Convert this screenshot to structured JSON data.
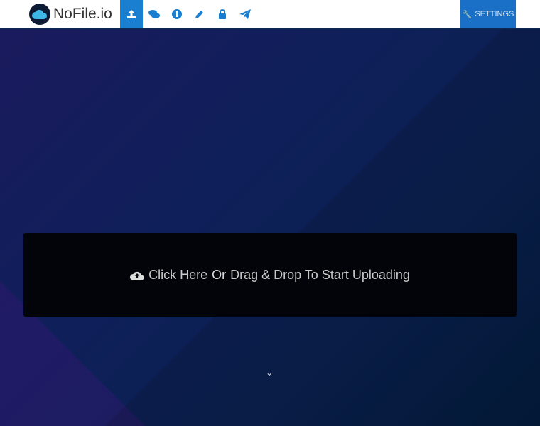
{
  "brand": {
    "name": "NoFile.io"
  },
  "nav": [
    {
      "icon": "upload-icon",
      "label": "Upload"
    },
    {
      "icon": "comments-icon",
      "label": "Chat"
    },
    {
      "icon": "info-icon",
      "label": "Info"
    },
    {
      "icon": "pencil-icon",
      "label": "Edit"
    },
    {
      "icon": "lock-icon",
      "label": "Secure"
    },
    {
      "icon": "paper-plane-icon",
      "label": "Send"
    }
  ],
  "settings": {
    "label": "SETTINGS"
  },
  "upload": {
    "pre": "Click Here",
    "or": "Or",
    "post": "Drag & Drop To Start Uploading"
  },
  "colors": {
    "accent": "#1a7fd0",
    "settings_bg": "#1a6fc7"
  }
}
